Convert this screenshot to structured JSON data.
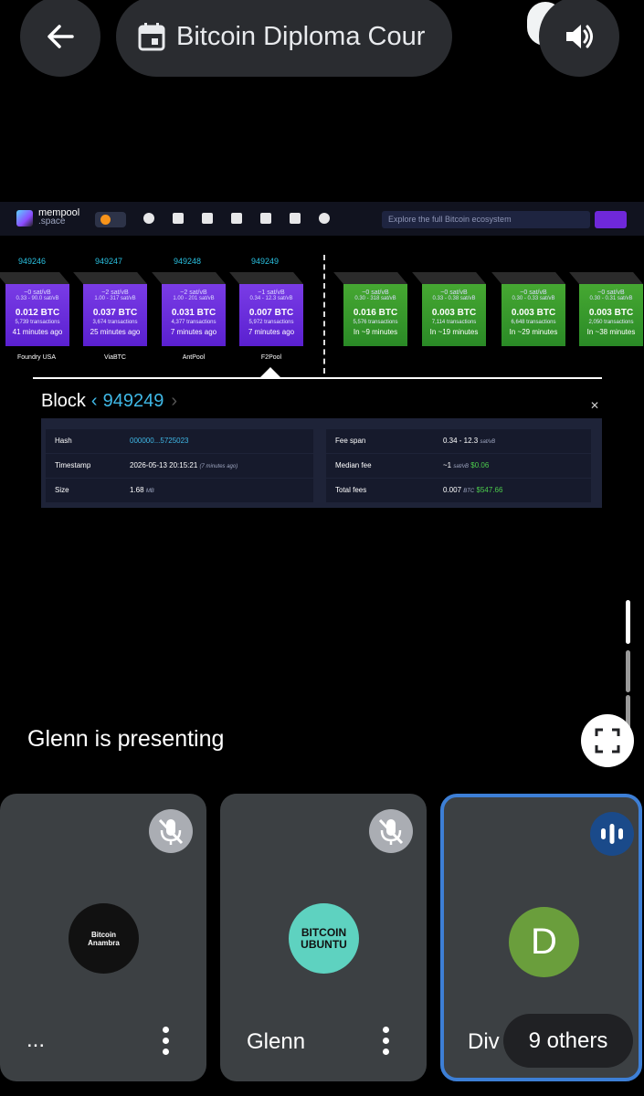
{
  "header": {
    "title": "Bitcoin Diploma Cour",
    "icons": {
      "back": "arrow-left-icon",
      "event": "calendar-icon",
      "audio": "volume-icon"
    }
  },
  "mempool": {
    "brand": "mempool",
    "brand_sub": ".space",
    "search_placeholder": "Explore the full Bitcoin ecosystem",
    "mined_blocks": [
      {
        "height": "949246",
        "fee": "~0 sat/vB",
        "span": "0.33 - 90.0 sat/vB",
        "btc": "0.012 BTC",
        "tx": "5,739 transactions",
        "ago": "41 minutes ago",
        "pool": "Foundry USA"
      },
      {
        "height": "949247",
        "fee": "~2 sat/vB",
        "span": "1.00 - 317 sat/vB",
        "btc": "0.037 BTC",
        "tx": "3,674 transactions",
        "ago": "25 minutes ago",
        "pool": "ViaBTC"
      },
      {
        "height": "949248",
        "fee": "~2 sat/vB",
        "span": "1.00 - 201 sat/vB",
        "btc": "0.031 BTC",
        "tx": "4,377 transactions",
        "ago": "7 minutes ago",
        "pool": "AntPool"
      },
      {
        "height": "949249",
        "fee": "~1 sat/vB",
        "span": "0.34 - 12.3 sat/vB",
        "btc": "0.007 BTC",
        "tx": "5,972 transactions",
        "ago": "7 minutes ago",
        "pool": "F2Pool"
      }
    ],
    "pending_blocks": [
      {
        "fee": "~0 sat/vB",
        "span": "0.30 - 318 sat/vB",
        "btc": "0.016 BTC",
        "tx": "5,576 transactions",
        "eta": "In ~9 minutes"
      },
      {
        "fee": "~0 sat/vB",
        "span": "0.33 - 0.38 sat/vB",
        "btc": "0.003 BTC",
        "tx": "7,114 transactions",
        "eta": "In ~19 minutes"
      },
      {
        "fee": "~0 sat/vB",
        "span": "0.30 - 0.33 sat/vB",
        "btc": "0.003 BTC",
        "tx": "6,648 transactions",
        "eta": "In ~29 minutes"
      },
      {
        "fee": "~0 sat/vB",
        "span": "0.30 - 0.31 sat/vB",
        "btc": "0.003 BTC",
        "tx": "2,050 transactions",
        "eta": "In ~38 minutes"
      }
    ],
    "block": {
      "label": "Block",
      "number": "949249",
      "hash_label": "Hash",
      "hash": "000000...5725023",
      "timestamp_label": "Timestamp",
      "timestamp": "2026-05-13 20:15:21",
      "timestamp_ago": "(7 minutes ago)",
      "size_label": "Size",
      "size": "1.68",
      "size_unit": "MB",
      "fee_span_label": "Fee span",
      "fee_span": "0.34 - 12.3",
      "fee_span_unit": "sat/vB",
      "median_fee_label": "Median fee",
      "median_fee": "~1",
      "median_fee_unit": "sat/vB",
      "median_fee_usd": "$0.06",
      "total_fees_label": "Total fees",
      "total_fees": "0.007",
      "total_fees_unit": "BTC",
      "total_fees_usd": "$547.66"
    }
  },
  "presenting_text": "Glenn is presenting",
  "participants": [
    {
      "name": "...",
      "avatar_text": "Bitcoin Anambra",
      "muted": true
    },
    {
      "name": "Glenn",
      "avatar_text": "BITCOIN UBUNTU",
      "muted": true
    },
    {
      "name": "Div",
      "avatar_text": "D",
      "speaking": true
    }
  ],
  "others_label": "9 others",
  "colors": {
    "accent_blue": "#3d7fd6",
    "mined_purple": "#6a2fe0",
    "pending_green": "#3a9a2e",
    "link_cyan": "#3fb8e6"
  }
}
